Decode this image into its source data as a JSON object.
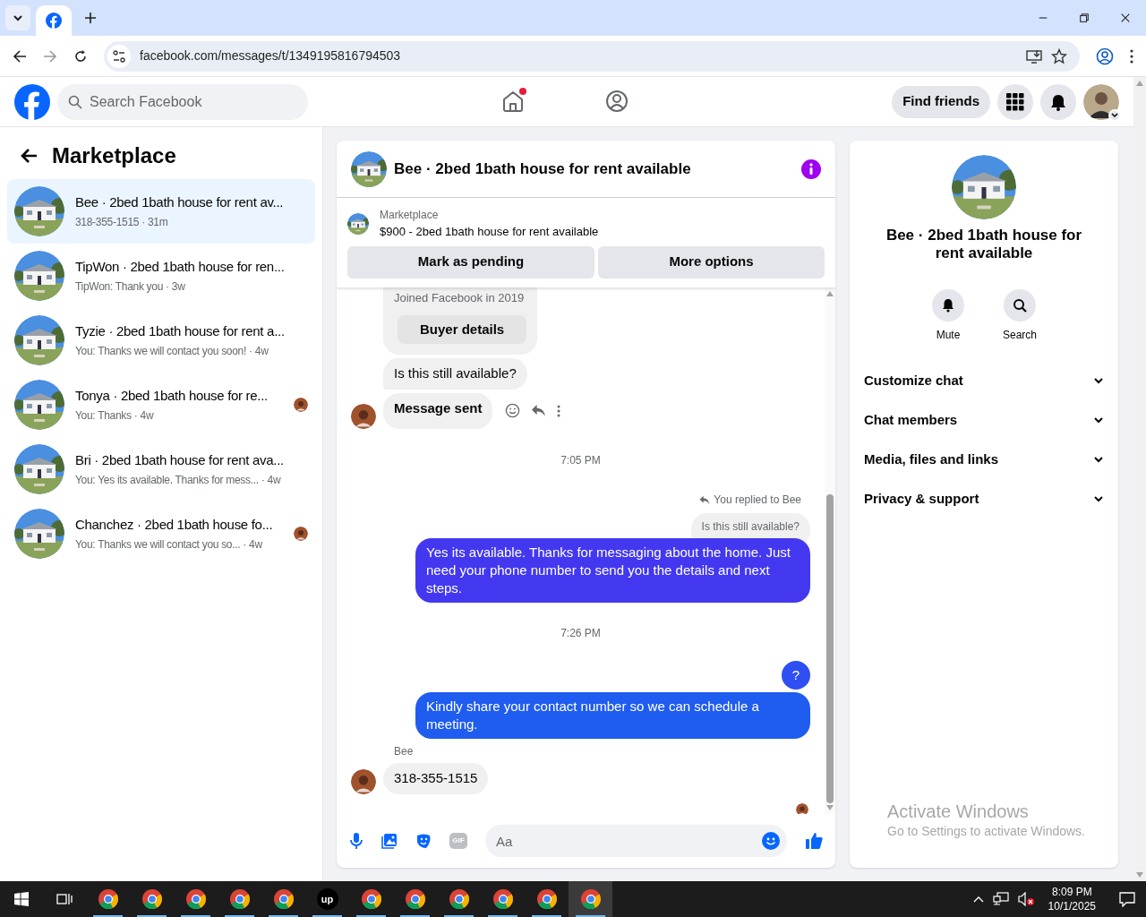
{
  "browser": {
    "url": "facebook.com/messages/t/1349195816794503"
  },
  "header": {
    "search": {
      "placeholder": "Search Facebook"
    },
    "home_notification": true,
    "find_friends": "Find friends"
  },
  "sidebar": {
    "title": "Marketplace",
    "conversations": [
      {
        "title": "Bee · 2bed 1bath house for rent av...",
        "preview": "318-355-1515 · 31m",
        "selected": true,
        "seen_by": false
      },
      {
        "title": "TipWon · 2bed 1bath house for ren...",
        "preview": "TipWon: Thank you · 3w",
        "selected": false,
        "seen_by": false
      },
      {
        "title": "Tyzie · 2bed 1bath house for rent a...",
        "preview": "You: Thanks we will contact you soon! · 4w",
        "selected": false,
        "seen_by": false
      },
      {
        "title": "Tonya · 2bed 1bath house for re...",
        "preview": "You: Thanks · 4w",
        "selected": false,
        "seen_by": true
      },
      {
        "title": "Bri · 2bed 1bath house for rent ava...",
        "preview": "You: Yes its available. Thanks for mess... · 4w",
        "selected": false,
        "seen_by": false
      },
      {
        "title": "Chanchez · 2bed 1bath house fo...",
        "preview": "You: Thanks we will contact you so... · 4w",
        "selected": false,
        "seen_by": true
      }
    ]
  },
  "chat": {
    "title": "Bee · 2bed 1bath house for rent available",
    "listing": {
      "source": "Marketplace",
      "item": "$900 - 2bed 1bath house for rent available",
      "buttons": [
        "Mark as pending",
        "More options"
      ]
    },
    "messages": [
      {
        "kind": "profile",
        "text": "Joined Facebook in 2019",
        "button": "Buyer details"
      },
      {
        "kind": "incoming",
        "text": "Is this still available?",
        "avatar": false,
        "bold": false
      },
      {
        "kind": "incoming",
        "text": "Message sent",
        "avatar": true,
        "bold": true
      },
      {
        "kind": "time",
        "text": "7:05 PM"
      },
      {
        "kind": "reply",
        "label": "You replied to Bee",
        "quote": "Is this still available?"
      },
      {
        "kind": "outgoing",
        "text": "Yes its available. Thanks for messaging about the home. Just need your phone number to send you the details and next steps.",
        "color": "#4338f0"
      },
      {
        "kind": "time",
        "text": "7:26 PM"
      },
      {
        "kind": "outgoing",
        "text": "?",
        "color": "#2f4ff2"
      },
      {
        "kind": "outgoing",
        "text": "Kindly share your contact number so we can schedule a meeting.",
        "color": "#1f5cf0"
      },
      {
        "kind": "sender",
        "text": "Bee"
      },
      {
        "kind": "incoming",
        "text": "318-355-1515",
        "avatar": true,
        "bold": false
      },
      {
        "kind": "seen"
      }
    ],
    "composer": {
      "placeholder": "Aa",
      "gif": "GIF"
    }
  },
  "details": {
    "title": "Bee · 2bed 1bath house for rent available",
    "actions": [
      "Mute",
      "Search"
    ],
    "sections": [
      {
        "label": "Customize chat",
        "expanded": false
      },
      {
        "label": "Chat members",
        "expanded": false
      },
      {
        "label": "Media, files and links",
        "expanded": false
      },
      {
        "label": "Privacy & support",
        "expanded": false
      }
    ]
  },
  "activation_notice": {
    "title": "Activate Windows",
    "text": "Go to Settings to activate Windows."
  },
  "taskbar": {
    "apps": [
      {
        "kind": "chrome"
      },
      {
        "kind": "chrome"
      },
      {
        "kind": "chrome"
      },
      {
        "kind": "chrome"
      },
      {
        "kind": "chrome"
      },
      {
        "kind": "upwork",
        "label": "up"
      },
      {
        "kind": "chrome"
      },
      {
        "kind": "chrome"
      },
      {
        "kind": "chrome"
      },
      {
        "kind": "chrome"
      },
      {
        "kind": "chrome"
      },
      {
        "kind": "chrome",
        "selected": true
      }
    ],
    "time": "8:09 PM",
    "date": "10/1/2025"
  }
}
